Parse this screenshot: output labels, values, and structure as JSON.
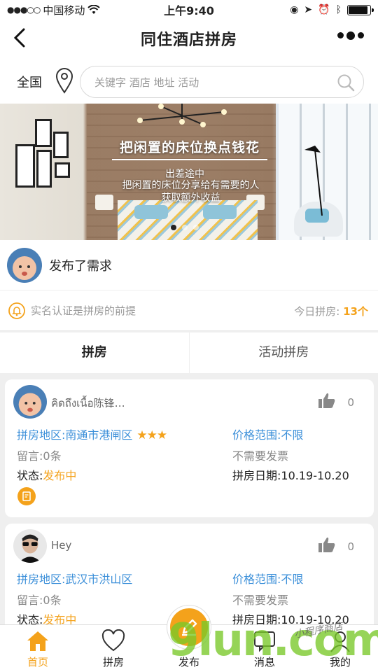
{
  "status_bar": {
    "carrier": "中国移动",
    "time": "上午9:40"
  },
  "nav": {
    "title": "同住酒店拼房"
  },
  "search": {
    "region": "全国",
    "placeholder": "关键字 酒店 地址 活动"
  },
  "banner": {
    "title": "把闲置的床位换点钱花",
    "hint": "出差途中",
    "subtitle_line1": "把闲置的床位分享给有需要的人",
    "subtitle_line2": "获取额外收益",
    "slides": 3,
    "active_slide": 1
  },
  "notice": {
    "text": "发布了需求"
  },
  "tip": {
    "text": "实名认证是拼房的前提",
    "count_label": "今日拼房:",
    "count_value": "13个"
  },
  "tabs": [
    {
      "label": "拼房",
      "active": true
    },
    {
      "label": "活动拼房",
      "active": false
    }
  ],
  "posts": [
    {
      "username": "คิดถึงเนื้อ陈锋…",
      "likes": "0",
      "area_label": "拼房地区:",
      "area": "南通市港闸区",
      "stars": "★★★",
      "comments": "留言:0条",
      "status_label": "状态:",
      "status": "发布中",
      "price": "价格范围:不限",
      "invoice": "不需要发票",
      "date": "拼房日期:10.19-10.20"
    },
    {
      "username": "Hey",
      "likes": "0",
      "area_label": "拼房地区:",
      "area": "武汉市洪山区",
      "comments": "留言:0条",
      "status_label": "状态:",
      "status": "发布中",
      "price": "价格范围:不限",
      "invoice": "不需要发票",
      "date": "拼房日期:10.19-10.20"
    }
  ],
  "tabbar": [
    {
      "label": "首页",
      "icon": "home-icon",
      "active": true
    },
    {
      "label": "拼房",
      "icon": "heart-icon",
      "active": false
    },
    {
      "label": "发布",
      "icon": "pencil-icon",
      "active": false
    },
    {
      "label": "消息",
      "icon": "message-icon",
      "active": false
    },
    {
      "label": "我的",
      "icon": "user-icon",
      "active": false
    }
  ],
  "watermark": {
    "text": "9lun.com",
    "subtext": "小程序商店"
  },
  "colors": {
    "accent": "#f4a21b",
    "link_blue": "#3b8fd9"
  }
}
